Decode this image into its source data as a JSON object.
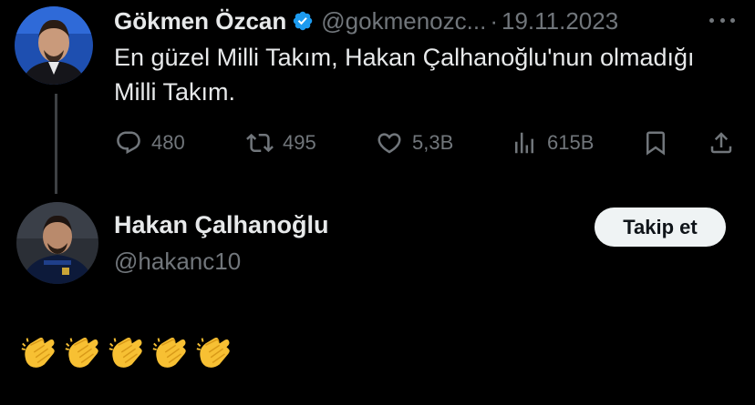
{
  "original_tweet": {
    "author_name": "Gökmen Özcan",
    "verified": true,
    "handle": "@gokmenozc...",
    "separator": "·",
    "date": "19.11.2023",
    "text": "En güzel Milli Takım, Hakan Çalhanoğlu'nun olmadığı Milli Takım.",
    "actions": {
      "replies": "480",
      "retweets": "495",
      "likes": "5,3B",
      "views": "615B"
    }
  },
  "reply": {
    "author_name": "Hakan Çalhanoğlu",
    "handle": "@hakanc10",
    "follow_label": "Takip et",
    "content_emoji": "clapping-hands",
    "emoji_count": 5
  },
  "colors": {
    "background": "#000000",
    "text": "#e7e9ea",
    "muted": "#71767b",
    "verified_blue": "#1d9bf0",
    "button_bg": "#eff3f4"
  }
}
